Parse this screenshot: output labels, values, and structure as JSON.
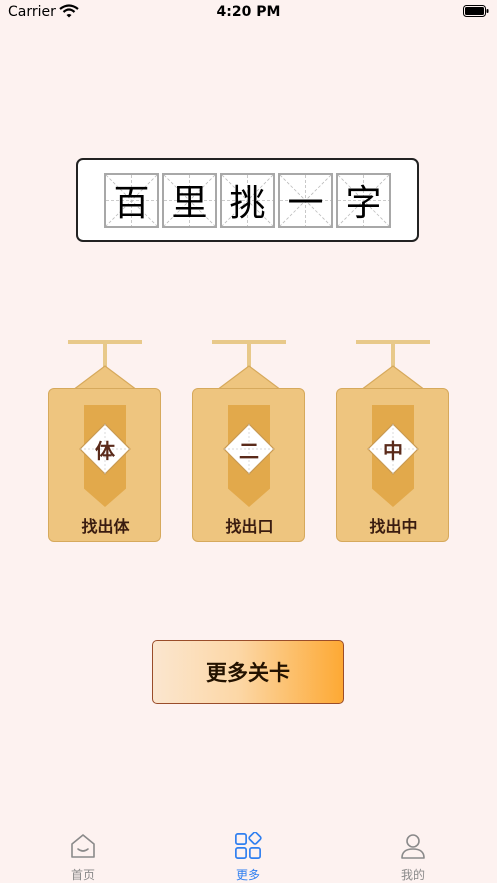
{
  "status_bar": {
    "carrier": "Carrier",
    "time": "4:20 PM",
    "icons": [
      "wifi-icon",
      "battery-icon"
    ]
  },
  "title_banner": {
    "characters": [
      "百",
      "里",
      "挑",
      "一",
      "字"
    ]
  },
  "levels": [
    {
      "character": "体",
      "label": "找出体"
    },
    {
      "character": "二",
      "label": "找出口"
    },
    {
      "character": "中",
      "label": "找出中"
    }
  ],
  "more_button": {
    "label": "更多关卡"
  },
  "tab_bar": {
    "items": [
      {
        "label": "首页",
        "icon": "home-icon",
        "active": false
      },
      {
        "label": "更多",
        "icon": "grid-icon",
        "active": true
      },
      {
        "label": "我的",
        "icon": "person-icon",
        "active": false
      }
    ]
  },
  "colors": {
    "background": "#fdf2f0",
    "card": "#eec57f",
    "bookmark": "#e2a94b",
    "active_tab": "#2f7ff0",
    "inactive_tab": "#8a8a8a"
  }
}
